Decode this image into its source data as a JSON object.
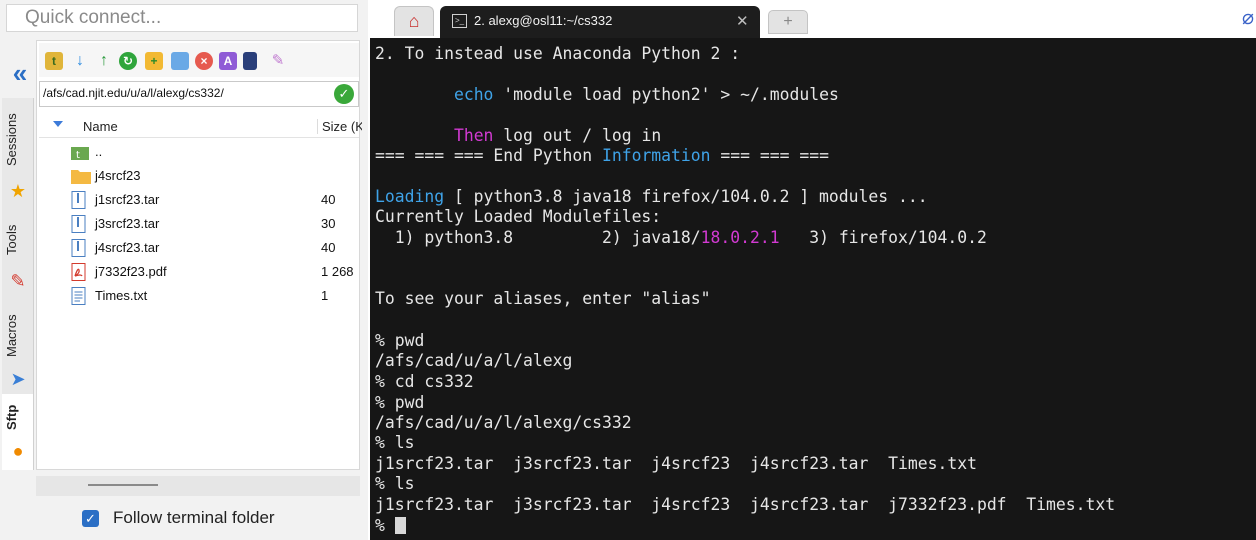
{
  "quick_connect": {
    "placeholder": "Quick connect..."
  },
  "side_tabs": [
    {
      "label": "Sessions",
      "icon": "star-icon"
    },
    {
      "label": "Tools",
      "icon": "tools-icon"
    },
    {
      "label": "Macros",
      "icon": "send-icon"
    },
    {
      "label": "Sftp",
      "icon": "sftp-icon"
    }
  ],
  "sftp": {
    "path": "/afs/cad.njit.edu/u/a/l/alexg/cs332/",
    "columns": {
      "name": "Name",
      "size": "Size (KB)"
    },
    "files": [
      {
        "name": "..",
        "size": "",
        "type": "parent-folder-icon"
      },
      {
        "name": "j4srcf23",
        "size": "",
        "type": "folder-icon"
      },
      {
        "name": "j1srcf23.tar",
        "size": "40",
        "type": "archive-file-icon"
      },
      {
        "name": "j3srcf23.tar",
        "size": "30",
        "type": "archive-file-icon"
      },
      {
        "name": "j4srcf23.tar",
        "size": "40",
        "type": "archive-file-icon"
      },
      {
        "name": "j7332f23.pdf",
        "size": "1 268",
        "type": "pdf-file-icon"
      },
      {
        "name": "Times.txt",
        "size": "1",
        "type": "text-file-icon"
      }
    ],
    "follow_terminal_label": "Follow terminal folder",
    "follow_terminal_checked": true
  },
  "tabs": {
    "terminal_title": "2. alexg@osl11:~/cs332"
  },
  "terminal": {
    "l1": "2. To instead use Anaconda Python 2 :",
    "l2_cmd": "echo",
    "l2_rest": " 'module load python2' > ~/.modules",
    "l3_kw": "Then",
    "l3_rest": " log out / log in",
    "l4_a": "=== === === End Python ",
    "l4_kw": "Information",
    "l4_b": " === === ===",
    "l5_kw": "Loading",
    "l5_rest": " [ python3.8 java18 firefox/104.0.2 ] modules ...",
    "l6": "Currently Loaded Modulefiles:",
    "l7_a": "  1) python3.8         2) java18/",
    "l7_ver": "18.0.2.1",
    "l7_b": "   3) firefox/104.0.2",
    "l8": "To see your aliases, enter \"alias\"",
    "l9": "% pwd",
    "l10": "/afs/cad/u/a/l/alexg",
    "l11": "% cd cs332",
    "l12": "% pwd",
    "l13": "/afs/cad/u/a/l/alexg/cs332",
    "l14": "% ls",
    "l15": "j1srcf23.tar  j3srcf23.tar  j4srcf23  j4srcf23.tar  Times.txt",
    "l16": "% ls",
    "l17": "j1srcf23.tar  j3srcf23.tar  j4srcf23  j4srcf23.tar  j7332f23.pdf  Times.txt",
    "l18_prompt": "% "
  },
  "colors": {
    "terminal_bg": "#161616",
    "terminal_fg": "#e6e6e6",
    "keyword_blue": "#3fa3e8",
    "keyword_magenta": "#d23ad2",
    "accent": "#2b6fc5"
  }
}
